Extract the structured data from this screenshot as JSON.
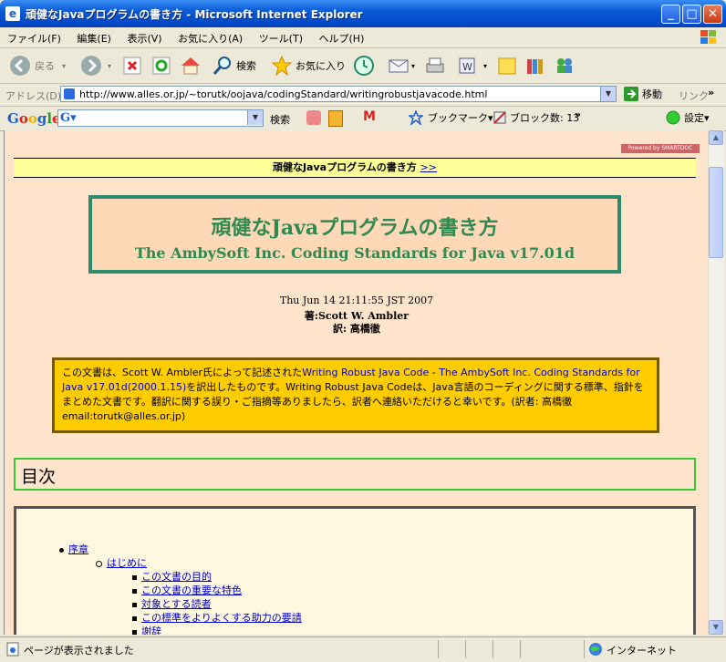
{
  "window": {
    "title": "頑健なJavaプログラムの書き方 - Microsoft Internet Explorer"
  },
  "menu": [
    "ファイル(F)",
    "編集(E)",
    "表示(V)",
    "お気に入り(A)",
    "ツール(T)",
    "ヘルプ(H)"
  ],
  "toolbar": {
    "back": "戻る",
    "search": "検索",
    "favorites": "お気に入り"
  },
  "address": {
    "label": "アドレス(D)",
    "url": "http://www.alles.or.jp/~torutk/oojava/codingStandard/writingrobustjavacode.html",
    "go": "移動",
    "links": "リンク"
  },
  "google": {
    "logo": "Google",
    "search": "検索",
    "bookmarks": "ブックマーク▾",
    "blocked": "ブロック数: 13",
    "settings": "設定▾"
  },
  "page": {
    "powered": "Powered by SMARTDOC",
    "header_title": "頑健なJavaプログラムの書き方",
    "header_link": ">>",
    "title_ja": "頑健なJavaプログラムの書き方",
    "title_en": "The AmbySoft Inc. Coding Standards for Java v17.01d",
    "date": "Thu Jun 14 21:11:55 JST 2007",
    "author": "著:Scott W. Ambler",
    "translator": "訳: 高橋徹",
    "notice_pre": "この文書は、Scott W. Ambler氏によって記述された",
    "notice_link": "Writing Robust Java Code - The AmbySoft Inc. Coding Standards for Java v17.01d(2000.1.15)",
    "notice_post": "を訳出したものです。Writing Robust Java Codeは、Java言語のコーディングに関する標準、指針をまとめた文書です。翻訳に関する誤り・ご指摘等ありましたら、訳者へ連絡いただけると幸いです。(訳者: 高橋徹 email:torutk@alles.or.jp)",
    "toc_heading": "目次",
    "toc": {
      "l1": "序章",
      "l2": "はじめに",
      "l3": [
        "この文書の目的",
        "この文書の重要な特色",
        "対象とする読者",
        "この標準をよりよくする助力の要請",
        "謝辞"
      ]
    }
  },
  "status": {
    "text": "ページが表示されました",
    "zone": "インターネット"
  }
}
